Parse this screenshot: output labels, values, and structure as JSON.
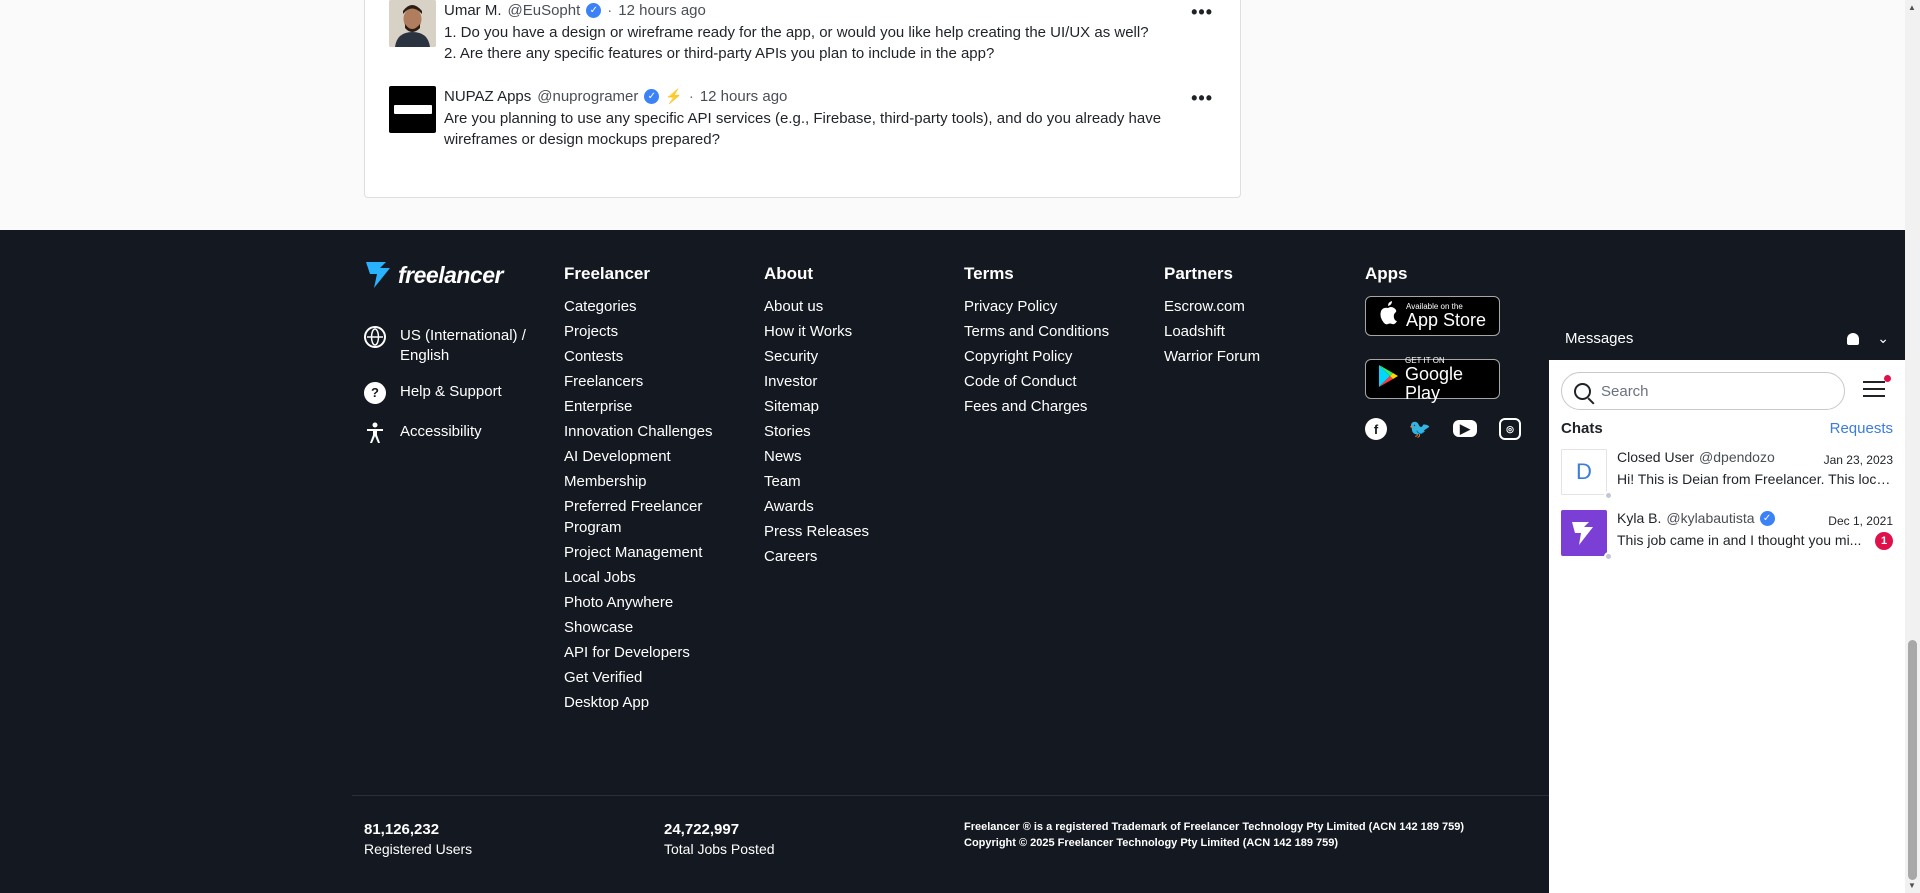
{
  "comments": [
    {
      "name": "Umar M.",
      "handle": "@EuSopht",
      "time": "12 hours ago",
      "lines": [
        "1. Do you have a design or wireframe ready for the app, or would you like help creating the UI/UX as well?",
        "2. Are there any specific features or third-party APIs you plan to include in the app?"
      ]
    },
    {
      "name": "NUPAZ Apps",
      "handle": "@nuprogramer",
      "time": "12 hours ago",
      "lines": [
        "Are you planning to use any specific API services (e.g., Firebase, third-party tools), and do you already have",
        "wireframes or design mockups prepared?"
      ]
    }
  ],
  "comment_separator": "·",
  "more_label": "•••",
  "footer": {
    "logo_text": "freelancer",
    "language": [
      "US (International) /",
      "English"
    ],
    "help": "Help & Support",
    "accessibility": "Accessibility",
    "columns": [
      {
        "title": "Freelancer",
        "links": [
          "Categories",
          "Projects",
          "Contests",
          "Freelancers",
          "Enterprise",
          "Innovation Challenges",
          "AI Development",
          "Membership",
          "Preferred Freelancer",
          "Program",
          "Project Management",
          "Local Jobs",
          "Photo Anywhere",
          "Showcase",
          "API for Developers",
          "Get Verified",
          "Desktop App"
        ]
      },
      {
        "title": "About",
        "links": [
          "About us",
          "How it Works",
          "Security",
          "Investor",
          "Sitemap",
          "Stories",
          "News",
          "Team",
          "Awards",
          "Press Releases",
          "Careers"
        ]
      },
      {
        "title": "Terms",
        "links": [
          "Privacy Policy",
          "Terms and Conditions",
          "Copyright Policy",
          "Code of Conduct",
          "Fees and Charges"
        ]
      },
      {
        "title": "Partners",
        "links": [
          "Escrow.com",
          "Loadshift",
          "Warrior Forum"
        ]
      }
    ],
    "apps": {
      "title": "Apps",
      "app_store": {
        "small": "Available on the",
        "big": "App Store"
      },
      "google_play": {
        "small": "GET IT ON",
        "big": "Google Play"
      }
    },
    "stats": [
      {
        "value": "81,126,232",
        "label": "Registered Users"
      },
      {
        "value": "24,722,997",
        "label": "Total Jobs Posted"
      }
    ],
    "legal": [
      "Freelancer ® is a registered Trademark of Freelancer Technology Pty Limited (ACN 142 189 759)",
      "Copyright © 2025 Freelancer Technology Pty Limited (ACN 142 189 759)"
    ]
  },
  "messages": {
    "title": "Messages",
    "search_placeholder": "Search",
    "chats_label": "Chats",
    "requests_label": "Requests",
    "chats": [
      {
        "initial": "D",
        "name": "Closed User",
        "handle": "@dpendozo",
        "date": "Jan 23, 2023",
        "preview": "Hi! This is Deian from Freelancer. This loca..."
      },
      {
        "initial": "",
        "name": "Kyla B.",
        "handle": "@kylabautista",
        "date": "Dec 1, 2021",
        "preview": "This job came in and I thought you mi...",
        "unread": "1"
      }
    ]
  },
  "colors": {
    "footer_bg": "#141820",
    "accent_blue": "#3b7dd8",
    "badge_red": "#e0104b",
    "verified_blue": "#3b82f6"
  },
  "icons": [
    "verified-icon",
    "more-icon",
    "globe-icon",
    "help-icon",
    "accessibility-icon",
    "apple-icon",
    "google-play-icon",
    "facebook-icon",
    "twitter-icon",
    "youtube-icon",
    "instagram-icon",
    "bell-icon",
    "chevron-down-icon",
    "search-icon",
    "filter-icon"
  ]
}
